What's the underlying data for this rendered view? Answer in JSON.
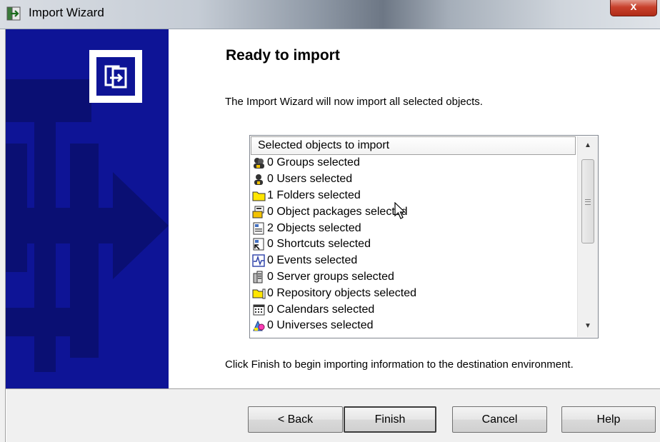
{
  "window": {
    "title": "Import Wizard",
    "close_label": "x"
  },
  "main": {
    "heading": "Ready to import",
    "intro": "The Import Wizard will now import all selected objects.",
    "list_header": "Selected objects to import",
    "items": [
      {
        "icon": "groups-icon",
        "label": "0 Groups selected"
      },
      {
        "icon": "users-icon",
        "label": "0 Users selected"
      },
      {
        "icon": "folder-icon",
        "label": "1 Folders selected"
      },
      {
        "icon": "object-packages-icon",
        "label": "0 Object packages selected"
      },
      {
        "icon": "objects-icon",
        "label": "2 Objects selected"
      },
      {
        "icon": "shortcuts-icon",
        "label": "0 Shortcuts selected"
      },
      {
        "icon": "events-icon",
        "label": "0 Events selected"
      },
      {
        "icon": "server-groups-icon",
        "label": "0 Server groups selected"
      },
      {
        "icon": "repository-icon",
        "label": "0 Repository objects selected"
      },
      {
        "icon": "calendar-icon",
        "label": "0 Calendars selected"
      },
      {
        "icon": "universe-icon",
        "label": "0 Universes selected"
      }
    ],
    "finish_note": "Click Finish to begin importing information to the destination environment."
  },
  "buttons": {
    "back": "< Back",
    "finish": "Finish",
    "cancel": "Cancel",
    "help": "Help"
  },
  "colors": {
    "banner": "#0e1496",
    "close": "#c8412c"
  }
}
